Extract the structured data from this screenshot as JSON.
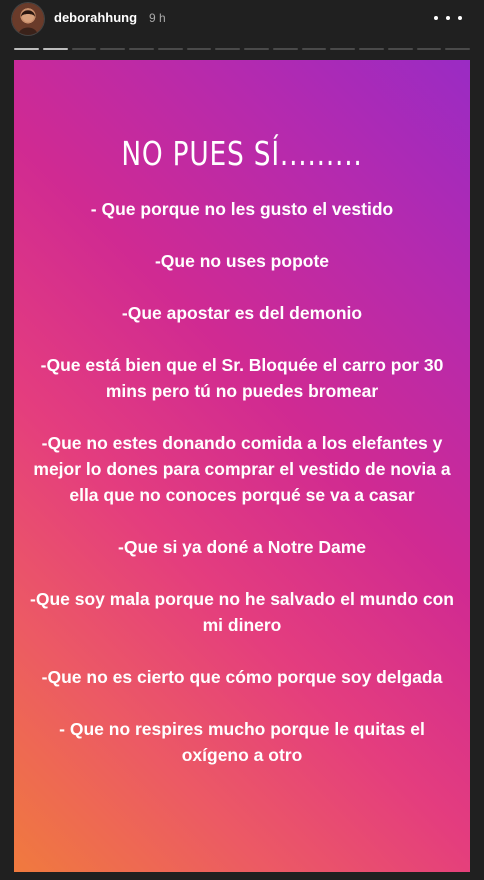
{
  "header": {
    "username": "deborahhung",
    "time": "9 h",
    "progress": {
      "segments": 16,
      "current": 2
    }
  },
  "story": {
    "title": "NO PUES SÍ.........",
    "lines": [
      "- Que porque no les gusto el vestido",
      "-Que no uses popote",
      "-Que apostar es del demonio",
      "-Que está bien que el Sr. Bloquée el carro por 30 mins pero tú no puedes bromear",
      "-Que no estes donando comida a los elefantes y mejor lo dones para comprar el vestido de novia a ella que no conoces porqué se va a casar",
      "-Que si ya doné a Notre Dame",
      "-Que soy mala porque no he salvado el mundo con mi dinero",
      "-Que no es cierto que cómo porque soy delgada",
      "- Que no respires mucho porque le quitas el oxígeno a otro"
    ]
  },
  "colors": {
    "gradient_top_right": "#9a2bc4",
    "gradient_middle": "#e43d7e",
    "gradient_bottom_left": "#f07a3e",
    "background": "#202020"
  },
  "icons": [
    "avatar",
    "more-options-icon"
  ]
}
